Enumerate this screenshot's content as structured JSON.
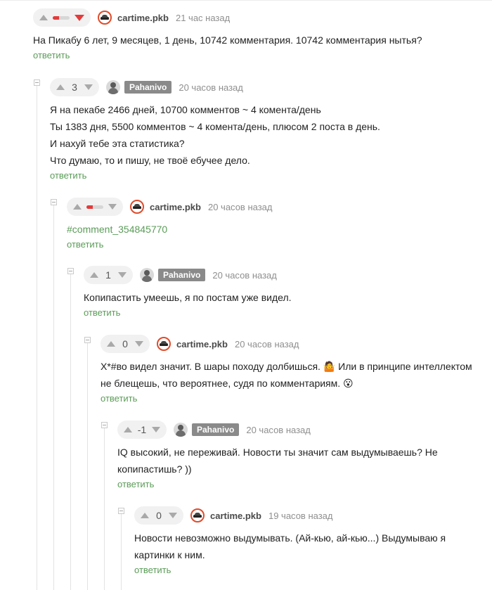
{
  "comments": [
    {
      "author": "cartime.pkb",
      "time": "21 час назад",
      "rating": "",
      "lines": [
        "На Пикабу 6 лет, 9 месяцев, 1 день, 10742 комментария. 10742 комментария нытья?"
      ],
      "reply_label": "ответить"
    },
    {
      "author": "Pahanivo",
      "time": "20 часов назад",
      "rating": "3",
      "lines": [
        "Я на пекабе 2466 дней, 10700 комментов ~ 4 комента/день",
        "Ты 1383 дня, 5500 комментов ~ 4 комента/день, плюсом 2 поста в день.",
        "И нахуй тебе эта статистика?",
        "Что думаю, то и пишу, не твоё ебучее дело."
      ],
      "reply_label": "ответить"
    },
    {
      "author": "cartime.pkb",
      "time": "20 часов назад",
      "rating": "",
      "lines": [
        "#comment_354845770"
      ],
      "reply_label": "ответить"
    },
    {
      "author": "Pahanivo",
      "time": "20 часов назад",
      "rating": "1",
      "lines": [
        "Копипастить умеешь, я по постам уже видел."
      ],
      "reply_label": "ответить"
    },
    {
      "author": "cartime.pkb",
      "time": "20 часов назад",
      "rating": "0",
      "lines": [
        "Х*#во видел значит. В шары походу долбишься. 🤷 Или в принципе интеллектом",
        "не блещешь, что вероятнее, судя по комментариям. 😮"
      ],
      "reply_label": "ответить"
    },
    {
      "author": "Pahanivo",
      "time": "20 часов назад",
      "rating": "-1",
      "lines": [
        "IQ высокий, не переживай. Новости ты значит сам выдумываешь? Не",
        "копипастишь? ))"
      ],
      "reply_label": "ответить"
    },
    {
      "author": "cartime.pkb",
      "time": "19 часов назад",
      "rating": "0",
      "lines": [
        "Новости невозможно выдумывать. (Ай-кью, ай-кью...) Выдумываю я",
        "картинки к ним."
      ],
      "reply_label": "ответить"
    }
  ],
  "colors": {
    "accent_green": "#5b9c58",
    "downvote_red": "#e33b3b",
    "tag_gray": "#8a8a8a"
  }
}
